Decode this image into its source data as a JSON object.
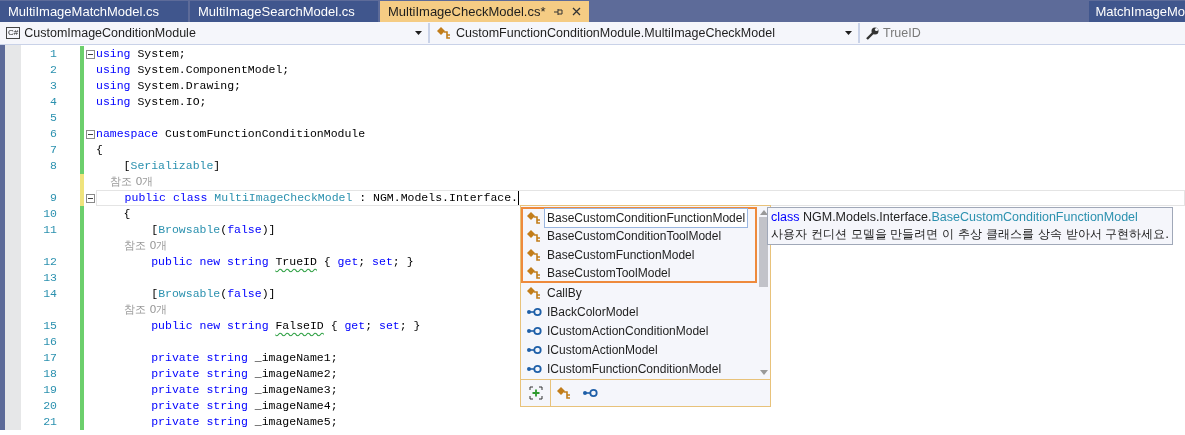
{
  "tabs": [
    {
      "label": "MultiImageMatchModel.cs",
      "selected": false
    },
    {
      "label": "MultiImageSearchModel.cs",
      "selected": false
    },
    {
      "label": "MultiImageCheckModel.cs*",
      "selected": true
    }
  ],
  "side_tab": {
    "label": "MatchImageMo"
  },
  "nav": {
    "project_icon": "C#",
    "project": "CustomImageConditionModule",
    "type": "CustomFunctionConditionModule.MultiImageCheckModel",
    "member": "TrueID"
  },
  "code": [
    {
      "number": "1",
      "unsaved": false,
      "fold": true,
      "tokens": [
        {
          "kind": "kw",
          "text": "using"
        },
        {
          "kind": "text",
          "text": " System;"
        }
      ]
    },
    {
      "number": "2",
      "unsaved": false,
      "tokens": [
        {
          "kind": "kw",
          "text": "using"
        },
        {
          "kind": "text",
          "text": " System.ComponentModel;"
        }
      ]
    },
    {
      "number": "3",
      "unsaved": false,
      "tokens": [
        {
          "kind": "kw",
          "text": "using"
        },
        {
          "kind": "text",
          "text": " System.Drawing;"
        }
      ]
    },
    {
      "number": "4",
      "unsaved": false,
      "tokens": [
        {
          "kind": "kw",
          "text": "using"
        },
        {
          "kind": "text",
          "text": " System.IO;"
        }
      ]
    },
    {
      "number": "5",
      "unsaved": false
    },
    {
      "number": "6",
      "unsaved": false,
      "fold": true,
      "tokens": [
        {
          "kind": "kw",
          "text": "namespace"
        },
        {
          "kind": "text",
          "text": " CustomFunctionConditionModule"
        }
      ]
    },
    {
      "number": "7",
      "unsaved": false,
      "tokens": [
        {
          "kind": "text",
          "text": "{"
        }
      ]
    },
    {
      "number": "8",
      "unsaved": false,
      "tokens": [
        {
          "kind": "text",
          "text": "    ["
        },
        {
          "kind": "type",
          "text": "Serializable"
        },
        {
          "kind": "text",
          "text": "]"
        }
      ]
    },
    {
      "unsaved": true,
      "tokens": [
        {
          "kind": "lens",
          "text": "    참조 0개"
        }
      ]
    },
    {
      "number": "9",
      "unsaved": true,
      "fold": true,
      "cursor": true,
      "tokens": [
        {
          "kind": "kw",
          "text": "    public class"
        },
        {
          "kind": "type",
          "text": " MultiImageCheckModel"
        },
        {
          "kind": "text",
          "text": " : NGM.Models.Interface."
        }
      ]
    },
    {
      "number": "10",
      "unsaved": false,
      "tokens": [
        {
          "kind": "text",
          "text": "    {"
        }
      ]
    },
    {
      "number": "11",
      "unsaved": false,
      "tokens": [
        {
          "kind": "text",
          "text": "        ["
        },
        {
          "kind": "type",
          "text": "Browsable"
        },
        {
          "kind": "text",
          "text": "("
        },
        {
          "kind": "kw",
          "text": "false"
        },
        {
          "kind": "text",
          "text": ")]"
        }
      ]
    },
    {
      "unsaved": false,
      "tokens": [
        {
          "kind": "lens",
          "text": "        참조 0개"
        }
      ]
    },
    {
      "number": "12",
      "unsaved": false,
      "tokens": [
        {
          "kind": "kw",
          "text": "        public new string "
        },
        {
          "kind": "squiggle",
          "text": "TrueID"
        },
        {
          "kind": "text",
          "text": " { "
        },
        {
          "kind": "kw",
          "text": "get"
        },
        {
          "kind": "text",
          "text": "; "
        },
        {
          "kind": "kw",
          "text": "set"
        },
        {
          "kind": "text",
          "text": "; }"
        }
      ]
    },
    {
      "number": "13",
      "unsaved": false
    },
    {
      "number": "14",
      "unsaved": false,
      "tokens": [
        {
          "kind": "text",
          "text": "        ["
        },
        {
          "kind": "type",
          "text": "Browsable"
        },
        {
          "kind": "text",
          "text": "("
        },
        {
          "kind": "kw",
          "text": "false"
        },
        {
          "kind": "text",
          "text": ")]"
        }
      ]
    },
    {
      "unsaved": false,
      "tokens": [
        {
          "kind": "lens",
          "text": "        참조 0개"
        }
      ]
    },
    {
      "number": "15",
      "unsaved": false,
      "tokens": [
        {
          "kind": "kw",
          "text": "        public new string "
        },
        {
          "kind": "squiggle",
          "text": "FalseID"
        },
        {
          "kind": "text",
          "text": " { "
        },
        {
          "kind": "kw",
          "text": "get"
        },
        {
          "kind": "text",
          "text": "; "
        },
        {
          "kind": "kw",
          "text": "set"
        },
        {
          "kind": "text",
          "text": "; }"
        }
      ]
    },
    {
      "number": "16",
      "unsaved": false
    },
    {
      "number": "17",
      "unsaved": false,
      "tokens": [
        {
          "kind": "kw",
          "text": "        private string"
        },
        {
          "kind": "text",
          "text": " _imageName1;"
        }
      ]
    },
    {
      "number": "18",
      "unsaved": false,
      "tokens": [
        {
          "kind": "kw",
          "text": "        private string"
        },
        {
          "kind": "text",
          "text": " _imageName2;"
        }
      ]
    },
    {
      "number": "19",
      "unsaved": false,
      "tokens": [
        {
          "kind": "kw",
          "text": "        private string"
        },
        {
          "kind": "text",
          "text": " _imageName3;"
        }
      ]
    },
    {
      "number": "20",
      "unsaved": false,
      "tokens": [
        {
          "kind": "kw",
          "text": "        private string"
        },
        {
          "kind": "text",
          "text": " _imageName4;"
        }
      ]
    },
    {
      "number": "21",
      "unsaved": false,
      "tokens": [
        {
          "kind": "kw",
          "text": "        private string"
        },
        {
          "kind": "text",
          "text": " _imageName5;"
        }
      ]
    }
  ],
  "completion": {
    "items": [
      {
        "label": "BaseCustomConditionFunctionModel",
        "kind": "class",
        "selected": true,
        "highlighted": true
      },
      {
        "label": "BaseCustomConditionToolModel",
        "kind": "class",
        "selected": false,
        "highlighted": true
      },
      {
        "label": "BaseCustomFunctionModel",
        "kind": "class",
        "selected": false,
        "highlighted": true
      },
      {
        "label": "BaseCustomToolModel",
        "kind": "class",
        "selected": false,
        "highlighted": true
      },
      {
        "label": "CallBy",
        "kind": "class",
        "selected": false,
        "highlighted": false
      },
      {
        "label": "IBackColorModel",
        "kind": "interface",
        "selected": false,
        "highlighted": false
      },
      {
        "label": "ICustomActionConditionModel",
        "kind": "interface",
        "selected": false,
        "highlighted": false
      },
      {
        "label": "ICustomActionModel",
        "kind": "interface",
        "selected": false,
        "highlighted": false
      },
      {
        "label": "ICustomFunctionConditionModel",
        "kind": "interface",
        "selected": false,
        "highlighted": false
      }
    ],
    "filters": [
      {
        "kind": "class"
      },
      {
        "kind": "interface"
      }
    ],
    "tooltip": {
      "keyword": "class",
      "namespace": "NGM.Models.Interface.",
      "name": "BaseCustomConditionFunctionModel",
      "description": "사용자 컨디션 모델을 만들려면 이 추상 클래스를 상속 받아서 구현하세요."
    }
  }
}
